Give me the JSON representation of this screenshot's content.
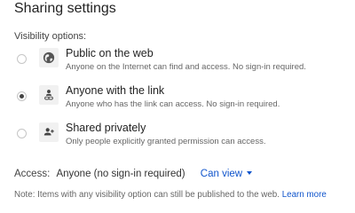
{
  "dialog": {
    "title": "Sharing settings"
  },
  "visibility": {
    "label": "Visibility options:",
    "options": [
      {
        "title": "Public on the web",
        "description": "Anyone on the Internet can find and access. No sign-in required.",
        "icon": "globe-icon",
        "selected": false
      },
      {
        "title": "Anyone with the link",
        "description": "Anyone who has the link can access. No sign-in required.",
        "icon": "link-person-icon",
        "selected": true
      },
      {
        "title": "Shared privately",
        "description": "Only people explicitly granted permission can access.",
        "icon": "people-icon",
        "selected": false
      }
    ]
  },
  "access": {
    "label": "Access:",
    "value": "Anyone (no sign-in required)",
    "permission": "Can view"
  },
  "note": {
    "text": "Note: Items with any visibility option can still be published to the web.",
    "link": "Learn more"
  },
  "colors": {
    "link": "#1155cc",
    "icon_bg": "#f1f1f1",
    "radio_dot": "#444444"
  }
}
